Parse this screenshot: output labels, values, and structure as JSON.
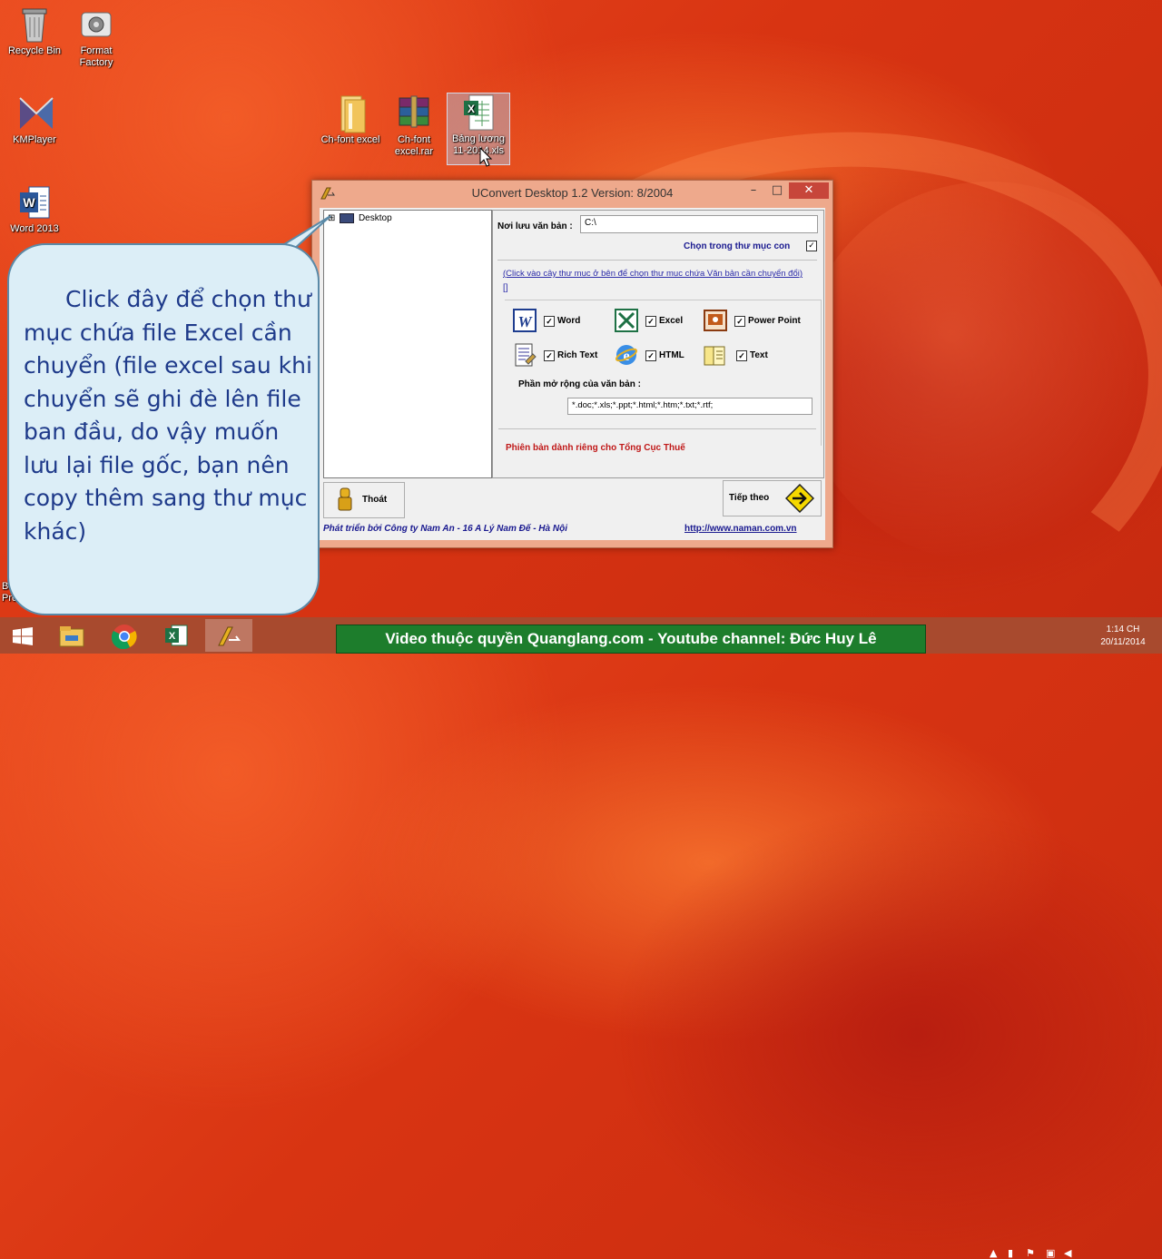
{
  "desktop": {
    "icons": [
      {
        "label": "Recycle Bin"
      },
      {
        "label": "Format Factory"
      },
      {
        "label": "KMPlayer"
      },
      {
        "label": "Word 2013"
      },
      {
        "label": "Ch-font excel"
      },
      {
        "label": "Ch-font excel.rar"
      },
      {
        "label": "Bảng lương 11-2014.xls"
      },
      {
        "label": "Bi Pro"
      }
    ]
  },
  "window": {
    "title": "UConvert Desktop 1.2   Version: 8/2004",
    "controls": {
      "minimize": "–",
      "maximize": "□",
      "close": "✕"
    },
    "tree_root": "Desktop",
    "tree_expander": "⊞",
    "save_label": "Nơi lưu văn bản :",
    "save_value": "C:\\",
    "subfolder_label": "Chọn trong thư mục con",
    "hint": "(Click vào cây thư mục ở bên để chọn thư mục chứa Văn bản cần chuyển đổi)",
    "hint_mark": "[]",
    "formats": [
      {
        "label": "Word",
        "icon": "word-icon",
        "checked": true
      },
      {
        "label": "Excel",
        "icon": "excel-icon",
        "checked": true
      },
      {
        "label": "Power Point",
        "icon": "powerpoint-icon",
        "checked": true
      },
      {
        "label": "Rich Text",
        "icon": "richtext-icon",
        "checked": true
      },
      {
        "label": "HTML",
        "icon": "html-icon",
        "checked": true
      },
      {
        "label": "Text",
        "icon": "text-icon",
        "checked": true
      }
    ],
    "ext_label": "Phần mở rộng của văn bản :",
    "ext_value": "*.doc;*.xls;*.ppt;*.html;*.htm;*.txt;*.rtf;",
    "edition_note": "Phiên bản dành riêng cho Tổng Cục Thuế",
    "exit_button": "Thoát",
    "next_button": "Tiếp theo",
    "footer_credit": "Phát triển bởi Công ty Nam An - 16 A Lý Nam Đế - Hà Nội",
    "footer_link": "http://www.naman.com.vn"
  },
  "callout": {
    "text": "Click đây để chọn thư mục chứa file Excel cần chuyển (file excel sau khi chuyển sẽ ghi đè lên file ban đầu, do vậy muốn lưu lại file gốc, bạn nên copy thêm sang thư mục khác)"
  },
  "taskbar": {
    "banner": "Video thuộc quyền Quanglang.com - Youtube channel: Đức Huy Lê",
    "time": "1:14 CH",
    "date": "20/11/2014"
  },
  "colors": {
    "callout_text": "#1e3a8a",
    "edition_note": "#c01818",
    "banner_bg": "#1d7d2c"
  }
}
